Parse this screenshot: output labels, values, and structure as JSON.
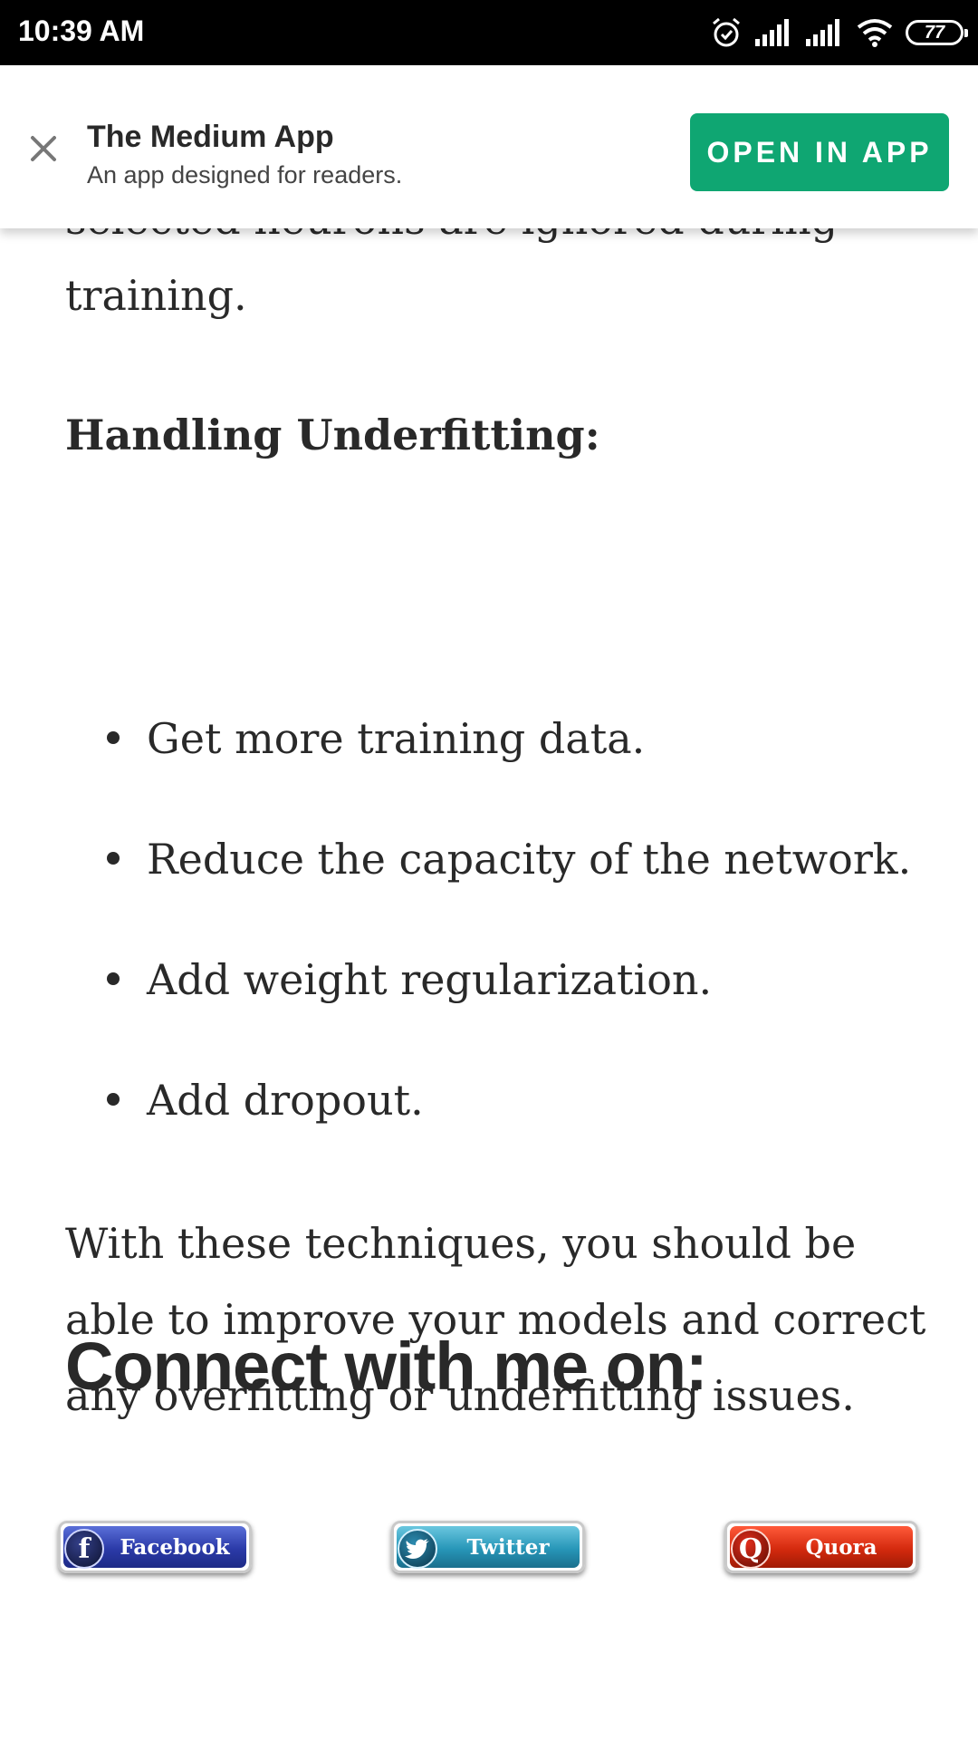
{
  "status_bar": {
    "time": "10:39 AM",
    "battery": "77",
    "icons": [
      "alarm-icon",
      "signal-icon",
      "signal-icon",
      "wifi-icon",
      "battery-icon"
    ]
  },
  "banner": {
    "close_icon": "close-icon",
    "title": "The Medium App",
    "subtitle": "An app designed for readers.",
    "open_button": "OPEN IN APP",
    "accent": "#0fa672"
  },
  "article": {
    "partial_top": "selected neurons are ignored during",
    "partial_end": "training.",
    "heading": "Handling Underfitting:",
    "bullets": [
      "Get more training data.",
      "Reduce the capacity of the network.",
      "Add weight regularization.",
      "Add dropout."
    ],
    "closing": [
      "With these techniques, you should be",
      "able to improve your models and correct",
      "any overfitting or underfitting issues."
    ],
    "connect_heading": "Connect with me on:"
  },
  "social": {
    "facebook": {
      "label": "Facebook",
      "logo": "f",
      "color": "#2b3aa8"
    },
    "twitter": {
      "label": "Twitter",
      "color": "#2796b8"
    },
    "quora": {
      "label": "Quora",
      "logo": "Q",
      "color": "#d42a0e"
    }
  }
}
